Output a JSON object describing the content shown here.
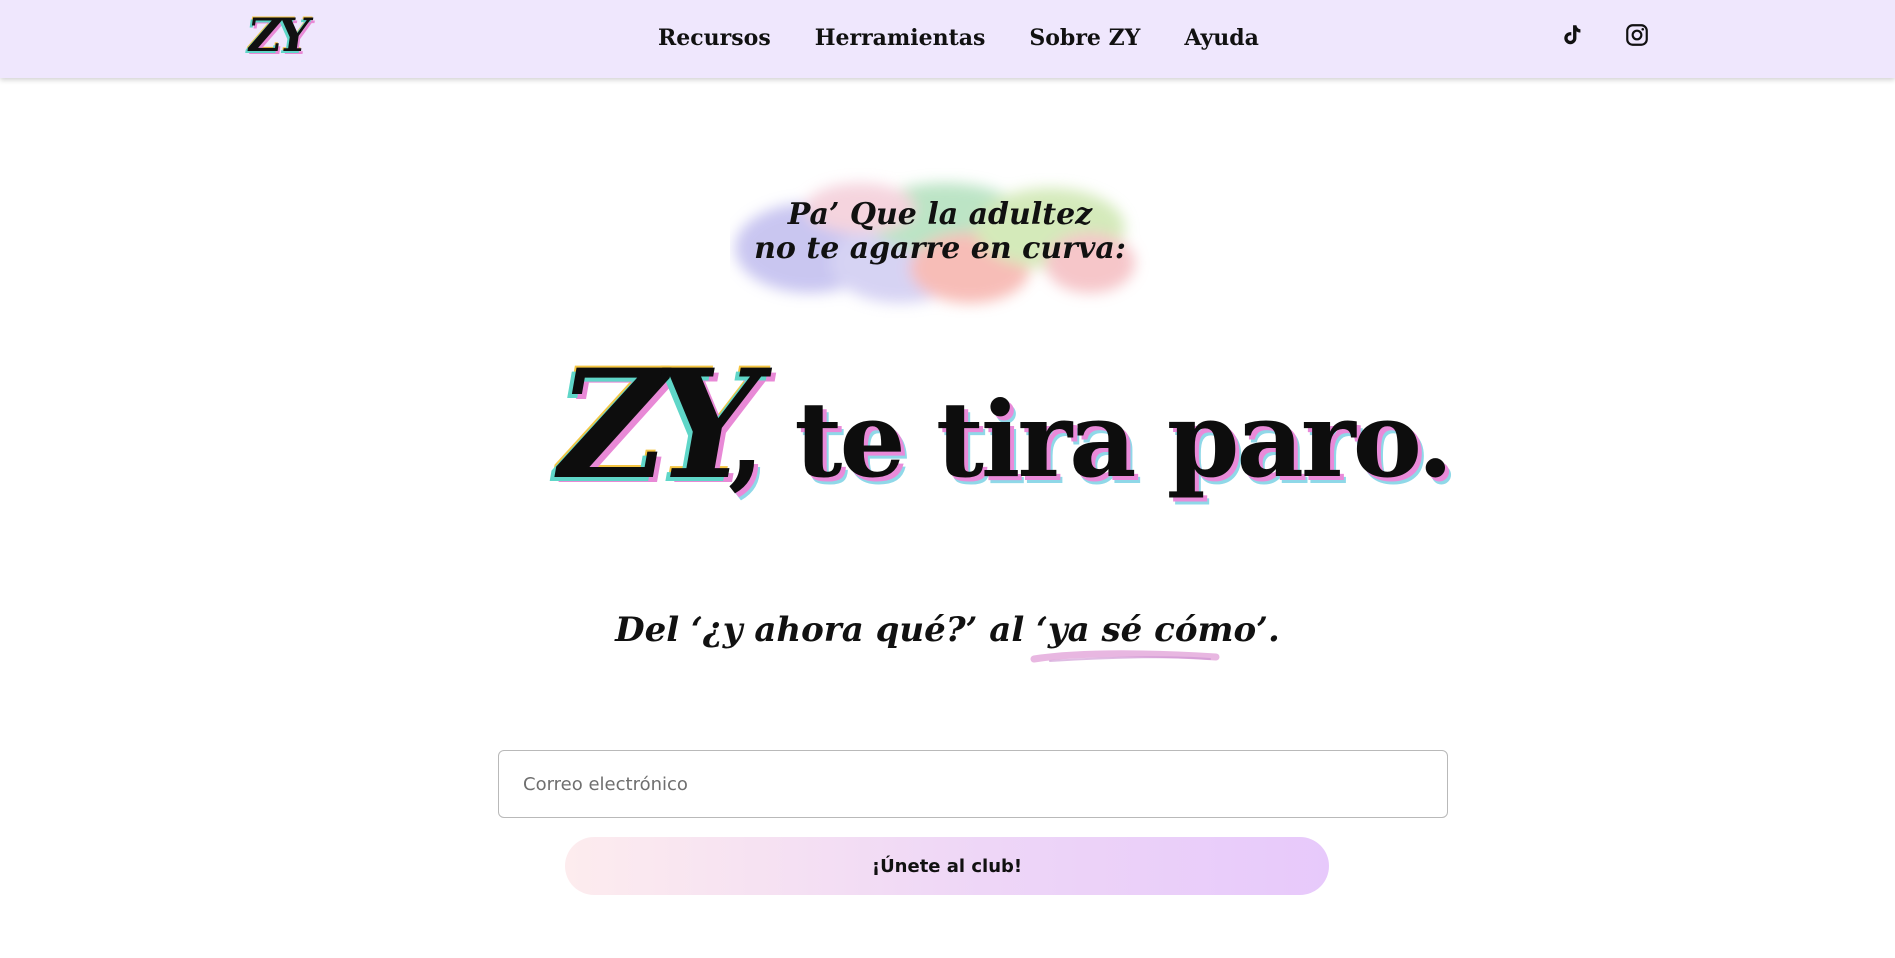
{
  "header": {
    "logo_text": "ZY",
    "nav": [
      {
        "label": "Recursos"
      },
      {
        "label": "Herramientas"
      },
      {
        "label": "Sobre ZY"
      },
      {
        "label": "Ayuda"
      }
    ],
    "social": [
      {
        "icon": "tiktok-icon"
      },
      {
        "icon": "instagram-icon"
      }
    ]
  },
  "hero": {
    "tagline_line1": "Pa’ Que la adultez",
    "tagline_line2": "no te agarre en curva:",
    "brand": "ZY",
    "headline_rest": ", te tira paro.",
    "subtitle": "Del ‘¿y ahora qué?’ al ‘ya sé cómo’."
  },
  "signup": {
    "email_placeholder": "Correo electrónico",
    "email_value": "",
    "button_label": "¡Únete al club!"
  },
  "colors": {
    "header_bg": "#efe7fd",
    "button_gradient_start": "#fdecee",
    "button_gradient_end": "#e7c9fb",
    "accent_pink": "#e889d6",
    "accent_teal": "#5fd6c8"
  }
}
